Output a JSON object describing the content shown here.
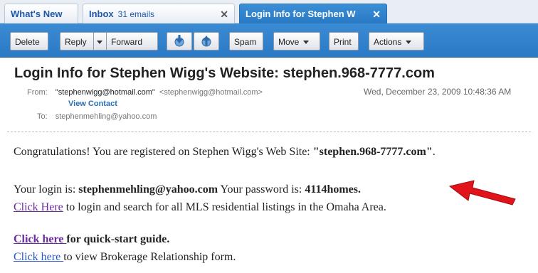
{
  "tabs": [
    {
      "label": "What's New",
      "count": ""
    },
    {
      "label": "Inbox",
      "count": "31 emails"
    },
    {
      "label": "Login Info for Stephen W",
      "count": ""
    }
  ],
  "toolbar": {
    "delete": "Delete",
    "reply": "Reply",
    "forward": "Forward",
    "spam": "Spam",
    "move": "Move",
    "print": "Print",
    "actions": "Actions"
  },
  "message": {
    "subject": "Login Info for Stephen Wigg's Website: stephen.968-7777.com",
    "from_label": "From:",
    "from_name": "\"stephenwigg@hotmail.com\"",
    "from_email": "<stephenwigg@hotmail.com>",
    "view_contact": "View Contact",
    "to_label": "To:",
    "to_email": "stephenmehling@yahoo.com",
    "date": "Wed, December 23, 2009 10:48:36 AM"
  },
  "body": {
    "line1_prefix": "Congratulations! You are registered on Stephen Wigg's Web Site: ",
    "line1_site": "\"stephen.968-7777.com\"",
    "line1_suffix": ".",
    "login_prefix": "Your login is: ",
    "login_value": "stephenmehling@yahoo.com",
    "password_prefix": " Your password is: ",
    "password_value": "4114homes.",
    "click_here_1": "Click Here",
    "line3_suffix": " to login and search for all MLS residential listings in the Omaha Area.",
    "click_here_2": "Click here ",
    "line4_suffix": "for quick-start guide.",
    "click_here_3": "Click here ",
    "line5_suffix": "to view Brokerage Relationship form."
  },
  "colors": {
    "accent": "#2a79c5",
    "link_visited": "#6a2ba0",
    "link": "#2a55c8",
    "annotation_arrow": "#e0141a"
  },
  "icons": [
    "close-icon",
    "down-arrow-icon",
    "up-arrow-icon",
    "caret-down-icon",
    "red-annotation-arrow"
  ]
}
